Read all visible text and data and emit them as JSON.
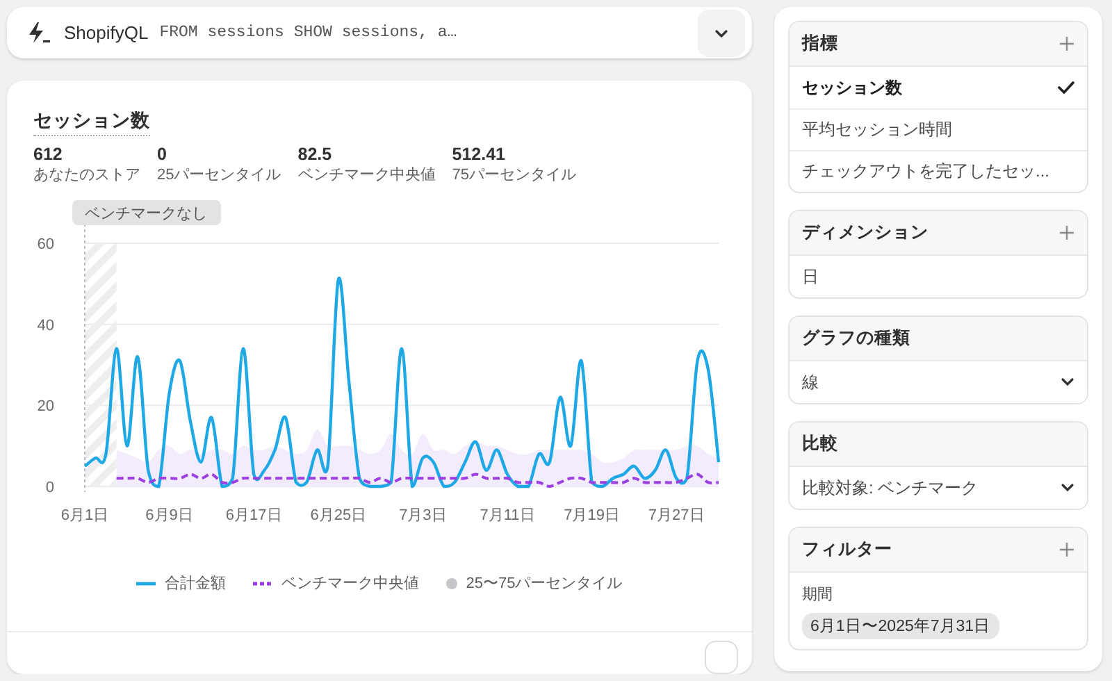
{
  "query_bar": {
    "label": "ShopifyQL",
    "query": "FROM sessions SHOW sessions, a…"
  },
  "metric_card": {
    "title": "セッション数",
    "stats": [
      {
        "value": "612",
        "label": "あなたのストア"
      },
      {
        "value": "0",
        "label": "25パーセンタイル"
      },
      {
        "value": "82.5",
        "label": "ベンチマーク中央値"
      },
      {
        "value": "512.41",
        "label": "75パーセンタイル"
      }
    ],
    "chart_data": {
      "type": "line",
      "categories": [
        "6月1日",
        null,
        null,
        null,
        null,
        null,
        null,
        null,
        "6月9日",
        null,
        null,
        null,
        null,
        null,
        null,
        null,
        "6月17日",
        null,
        null,
        null,
        null,
        null,
        null,
        null,
        "6月25日",
        null,
        null,
        null,
        null,
        null,
        null,
        null,
        "7月3日",
        null,
        null,
        null,
        null,
        null,
        null,
        null,
        "7月11日",
        null,
        null,
        null,
        null,
        null,
        null,
        null,
        "7月19日",
        null,
        null,
        null,
        null,
        null,
        null,
        null,
        "7月27日",
        null,
        null,
        null,
        null
      ],
      "ylim": [
        0,
        60
      ],
      "yticks": [
        0,
        20,
        40,
        60
      ],
      "annotations": [
        "ベンチマークなし"
      ],
      "series": [
        {
          "name": "合計金額",
          "type": "line",
          "line_style": "solid",
          "color": "#1ea8e6",
          "values": [
            5,
            7,
            8,
            34,
            10,
            32,
            4,
            0,
            23,
            31,
            16,
            6,
            17,
            0,
            2,
            34,
            3,
            4,
            9,
            17,
            1,
            1,
            9,
            5,
            51,
            26,
            2,
            0,
            0,
            1,
            34,
            0,
            7,
            6,
            0,
            1,
            6,
            11,
            4,
            9,
            3,
            0,
            0,
            8,
            6,
            22,
            10,
            31,
            1,
            0,
            2,
            3,
            5,
            2,
            4,
            9,
            2,
            2,
            31,
            29,
            6
          ]
        },
        {
          "name": "ベンチマーク中央値",
          "type": "line",
          "line_style": "dashed",
          "color": "#9b3fe0",
          "values": [
            null,
            null,
            null,
            2,
            2,
            2,
            1,
            2,
            2,
            2,
            3,
            2,
            3,
            1,
            1,
            2,
            2,
            2,
            2,
            2,
            2,
            2,
            2,
            2,
            2,
            2,
            2,
            1,
            2,
            1,
            2,
            2,
            2,
            2,
            2,
            2,
            2,
            3,
            2,
            2,
            2,
            1,
            1,
            1,
            0,
            1,
            2,
            2,
            1,
            1,
            1,
            1,
            2,
            1,
            1,
            1,
            1,
            2,
            3,
            1,
            1
          ]
        },
        {
          "name": "25〜75パーセンタイル",
          "type": "area",
          "color": "#f3ecfd",
          "values": [
            null,
            null,
            null,
            9,
            8,
            7,
            6,
            9,
            10,
            8,
            9,
            8,
            9,
            9,
            8,
            10,
            9,
            9,
            10,
            9,
            8,
            9,
            14,
            10,
            10,
            10,
            9,
            8,
            9,
            13,
            9,
            8,
            13,
            9,
            9,
            8,
            10,
            11,
            10,
            10,
            9,
            8,
            8,
            9,
            9,
            9,
            9,
            9,
            8,
            6,
            6,
            7,
            9,
            9,
            9,
            9,
            9,
            10,
            10,
            8,
            7
          ]
        }
      ]
    }
  },
  "sidebar": {
    "sections": [
      {
        "kind": "list",
        "title": "指標",
        "add": true,
        "items": [
          {
            "label": "セッション数",
            "selected": true
          },
          {
            "label": "平均セッション時間",
            "selected": false
          },
          {
            "label": "チェックアウトを完了したセッ...",
            "selected": false
          }
        ]
      },
      {
        "kind": "list",
        "title": "ディメンション",
        "add": true,
        "items": [
          {
            "label": "日",
            "selected": false
          }
        ]
      },
      {
        "kind": "select",
        "title": "グラフの種類",
        "add": false,
        "value": "線"
      },
      {
        "kind": "select",
        "title": "比較",
        "add": false,
        "value": "比較対象: ベンチマーク"
      },
      {
        "kind": "filter",
        "title": "フィルター",
        "add": true,
        "label": "期間",
        "chip": "6月1日〜2025年7月31日"
      }
    ]
  }
}
